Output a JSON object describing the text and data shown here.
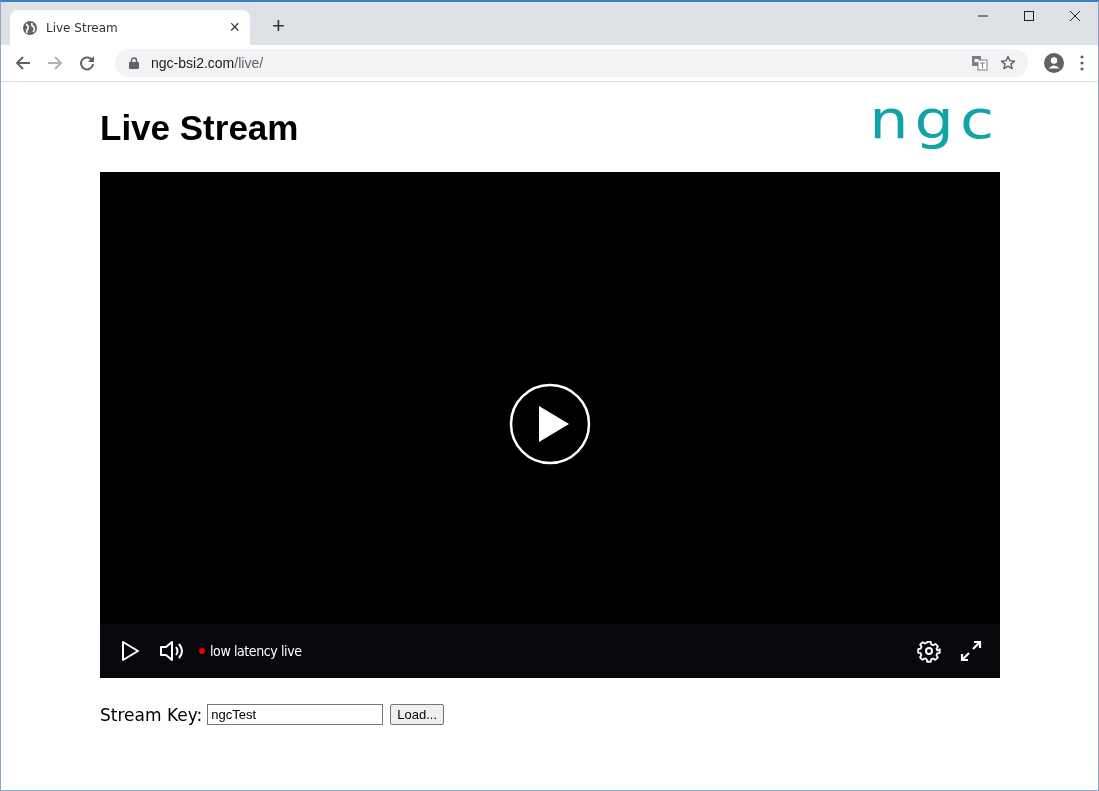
{
  "browser": {
    "tab": {
      "title": "Live Stream",
      "close": "×"
    },
    "new_tab": "+",
    "address": {
      "host": "ngc-bsi2.com",
      "path": "/live/"
    }
  },
  "page": {
    "title": "Live Stream",
    "logo": "ngc"
  },
  "player": {
    "live_label": "low latency live",
    "live": true
  },
  "stream_key": {
    "label": "Stream Key:",
    "value": "ngcTest",
    "button": "Load..."
  }
}
